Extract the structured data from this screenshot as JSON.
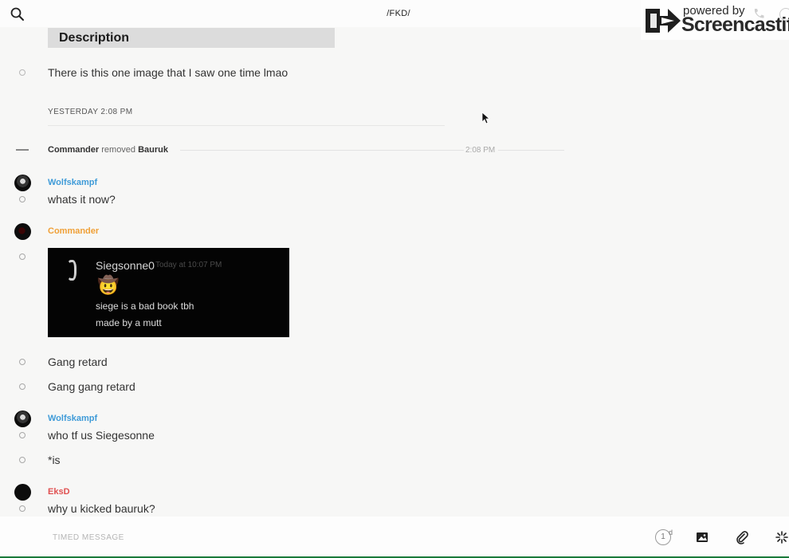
{
  "header": {
    "title": "/FKD/"
  },
  "overlay": {
    "powered_by": "powered by",
    "brand": "Screencastify"
  },
  "description": {
    "heading": "Description",
    "text": "There is this one image that I saw one time lmao"
  },
  "day_separator": "YESTERDAY 2:08 PM",
  "system_event": {
    "actor": "Commander",
    "action": "removed",
    "target": "Bauruk",
    "time": "2:08 PM"
  },
  "users": {
    "wolfskampf": {
      "name": "Wolfskampf",
      "color": "#3f9bd8"
    },
    "commander": {
      "name": "Commander",
      "color": "#f0a037"
    },
    "eksd": {
      "name": "EksD",
      "color": "#e05151"
    }
  },
  "messages": {
    "m1": "whats it now?",
    "m2": "Gang retard",
    "m3": "Gang gang retard",
    "m4": "who tf us Siegesonne",
    "m5": "*is",
    "m6": "why u kicked bauruk?"
  },
  "embed": {
    "username": "Siegsonne0",
    "timestamp": "Today at 10:07 PM",
    "emoji": "🤠",
    "line1": "siege is a bad book tbh",
    "line2": "made by a mutt"
  },
  "composer": {
    "placeholder": "TIMED MESSAGE",
    "timer_value": "1",
    "timer_unit": "d"
  },
  "icons": [
    "search-icon",
    "phone-icon",
    "info-icon",
    "image-icon",
    "paperclip-icon",
    "loading-icon",
    "cursor-icon"
  ]
}
